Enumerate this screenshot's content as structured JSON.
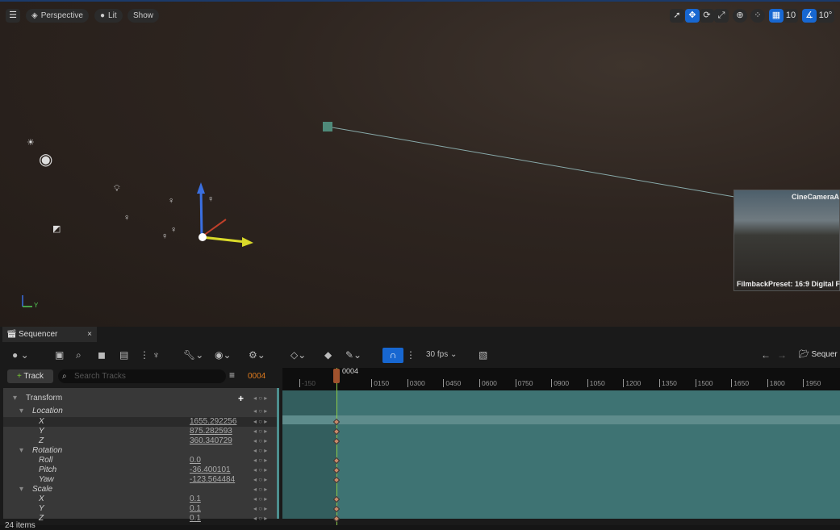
{
  "viewport": {
    "perspective_label": "Perspective",
    "lit_label": "Lit",
    "show_label": "Show",
    "grid_snap": "10",
    "rot_snap": "10°",
    "camera_preview": {
      "title": "CineCameraA",
      "filmback": "FilmbackPreset: 16:9 Digital F"
    },
    "axis_y": "Y",
    "tools": [
      "select-icon",
      "move-icon",
      "rotate-icon",
      "scale-icon",
      "world-icon",
      "surface-snap-icon",
      "grid-snap-icon",
      "rotation-snap-icon"
    ],
    "active_tool": "move-icon"
  },
  "sequencer": {
    "tab_title": "Sequencer",
    "fps": "30 fps",
    "sequence_label": "Sequer",
    "add_track": "Track",
    "search_placeholder": "Search Tracks",
    "current_frame": "0004",
    "playhead_label": "0004",
    "ruler_ticks": [
      "-150",
      "0150",
      "0300",
      "0450",
      "0600",
      "0750",
      "0900",
      "1050",
      "1200",
      "1350",
      "1500",
      "1650",
      "1800",
      "1950"
    ],
    "tracks": [
      {
        "label": "Transform",
        "value": "",
        "level": 0,
        "expand": true
      },
      {
        "label": "Location",
        "value": "",
        "level": 1,
        "expand": true
      },
      {
        "label": "X",
        "value": "1655.292256",
        "level": 2,
        "selected": true
      },
      {
        "label": "Y",
        "value": "875.282593",
        "level": 2
      },
      {
        "label": "Z",
        "value": "360.340729",
        "level": 2
      },
      {
        "label": "Rotation",
        "value": "",
        "level": 1,
        "expand": true
      },
      {
        "label": "Roll",
        "value": "0.0",
        "level": 2
      },
      {
        "label": "Pitch",
        "value": "-36.400101",
        "level": 2
      },
      {
        "label": "Yaw",
        "value": "-123.564484",
        "level": 2
      },
      {
        "label": "Scale",
        "value": "",
        "level": 1,
        "expand": true
      },
      {
        "label": "X",
        "value": "0.1",
        "level": 2
      },
      {
        "label": "Y",
        "value": "0.1",
        "level": 2
      },
      {
        "label": "Z",
        "value": "0.1",
        "level": 2
      }
    ],
    "items_count": "24 items",
    "colors": {
      "accent": "#1767d1",
      "frame": "#e07b1e",
      "track_lane": "#3e7373",
      "playhead": "#8fce4b"
    }
  }
}
